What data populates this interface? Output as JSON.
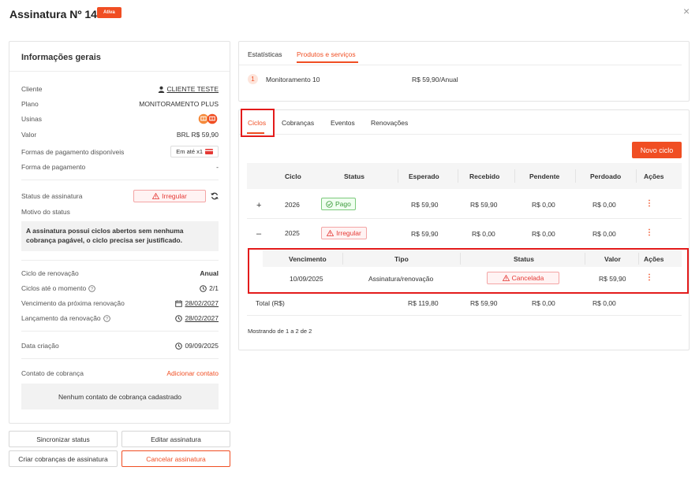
{
  "header": {
    "title": "Assinatura Nº 14646",
    "badge": "Ativa",
    "close": "×"
  },
  "general": {
    "title": "Informações gerais",
    "cliente_label": "Cliente",
    "cliente_value": "CLIENTE TESTE",
    "plano_label": "Plano",
    "plano_value": "MONITORAMENTO PLUS",
    "usinas_label": "Usinas",
    "valor_label": "Valor",
    "valor_value": "BRL R$ 59,90",
    "formas_label": "Formas de pagamento disponíveis",
    "formas_value": "Em até x1",
    "forma_label": "Forma de pagamento",
    "forma_value": "-",
    "status_label": "Status de assinatura",
    "status_value": "Irregular",
    "motivo_label": "Motivo do status",
    "motivo_text": "A assinatura possui ciclos abertos sem nenhuma cobrança pagável, o ciclo precisa ser justificado.",
    "ciclo_label": "Ciclo de renovação",
    "ciclo_value": "Anual",
    "ciclos_label": "Ciclos até o momento",
    "ciclos_value": "2/1",
    "venc_label": "Vencimento da próxima renovação",
    "venc_value": "28/02/2027",
    "lanc_label": "Lançamento da renovação",
    "lanc_value": "28/02/2027",
    "criacao_label": "Data criação",
    "criacao_value": "09/09/2025",
    "contato_label": "Contato de cobrança",
    "contato_action": "Adicionar contato",
    "contato_empty": "Nenhum contato de cobrança cadastrado"
  },
  "buttons": {
    "sync": "Sincronizar status",
    "edit": "Editar assinatura",
    "create": "Criar cobranças de assinatura",
    "cancel": "Cancelar assinatura"
  },
  "top_tabs": [
    "Estatísticas",
    "Produtos e serviços"
  ],
  "product": {
    "index": "1",
    "name": "Monitoramento 10",
    "price": "R$ 59,90/Anual"
  },
  "sub_tabs": [
    "Ciclos",
    "Cobranças",
    "Eventos",
    "Renovações"
  ],
  "novo_ciclo": "Novo ciclo",
  "cycles_table": {
    "headers": [
      "Ciclo",
      "Status",
      "Esperado",
      "Recebido",
      "Pendente",
      "Perdoado",
      "Ações"
    ],
    "rows": [
      {
        "toggle": "+",
        "ciclo": "2026",
        "status": "Pago",
        "esperado": "R$ 59,90",
        "recebido": "R$ 59,90",
        "pendente": "R$ 0,00",
        "perdoado": "R$ 0,00",
        "acoes": "⋮"
      },
      {
        "toggle": "–",
        "ciclo": "2025",
        "status": "Irregular",
        "esperado": "R$ 59,90",
        "recebido": "R$ 0,00",
        "pendente": "R$ 0,00",
        "perdoado": "R$ 0,00",
        "acoes": "⋮"
      }
    ],
    "total": {
      "label": "Total (R$)",
      "esperado": "R$ 119,80",
      "recebido": "R$ 59,90",
      "pendente": "R$ 0,00",
      "perdoado": "R$ 0,00"
    },
    "footer": "Mostrando de 1 a 2 de 2"
  },
  "sub_table": {
    "headers": [
      "Vencimento",
      "Tipo",
      "Status",
      "Valor",
      "Ações"
    ],
    "row": {
      "vencimento": "10/09/2025",
      "tipo": "Assinatura/renovação",
      "status": "Cancelada",
      "valor": "R$ 59,90",
      "acoes": "⋮"
    }
  },
  "colors": {
    "accent": "#f04e23",
    "highlight": "#e31b1b",
    "success": "#3a9a3a",
    "error": "#e53935"
  }
}
